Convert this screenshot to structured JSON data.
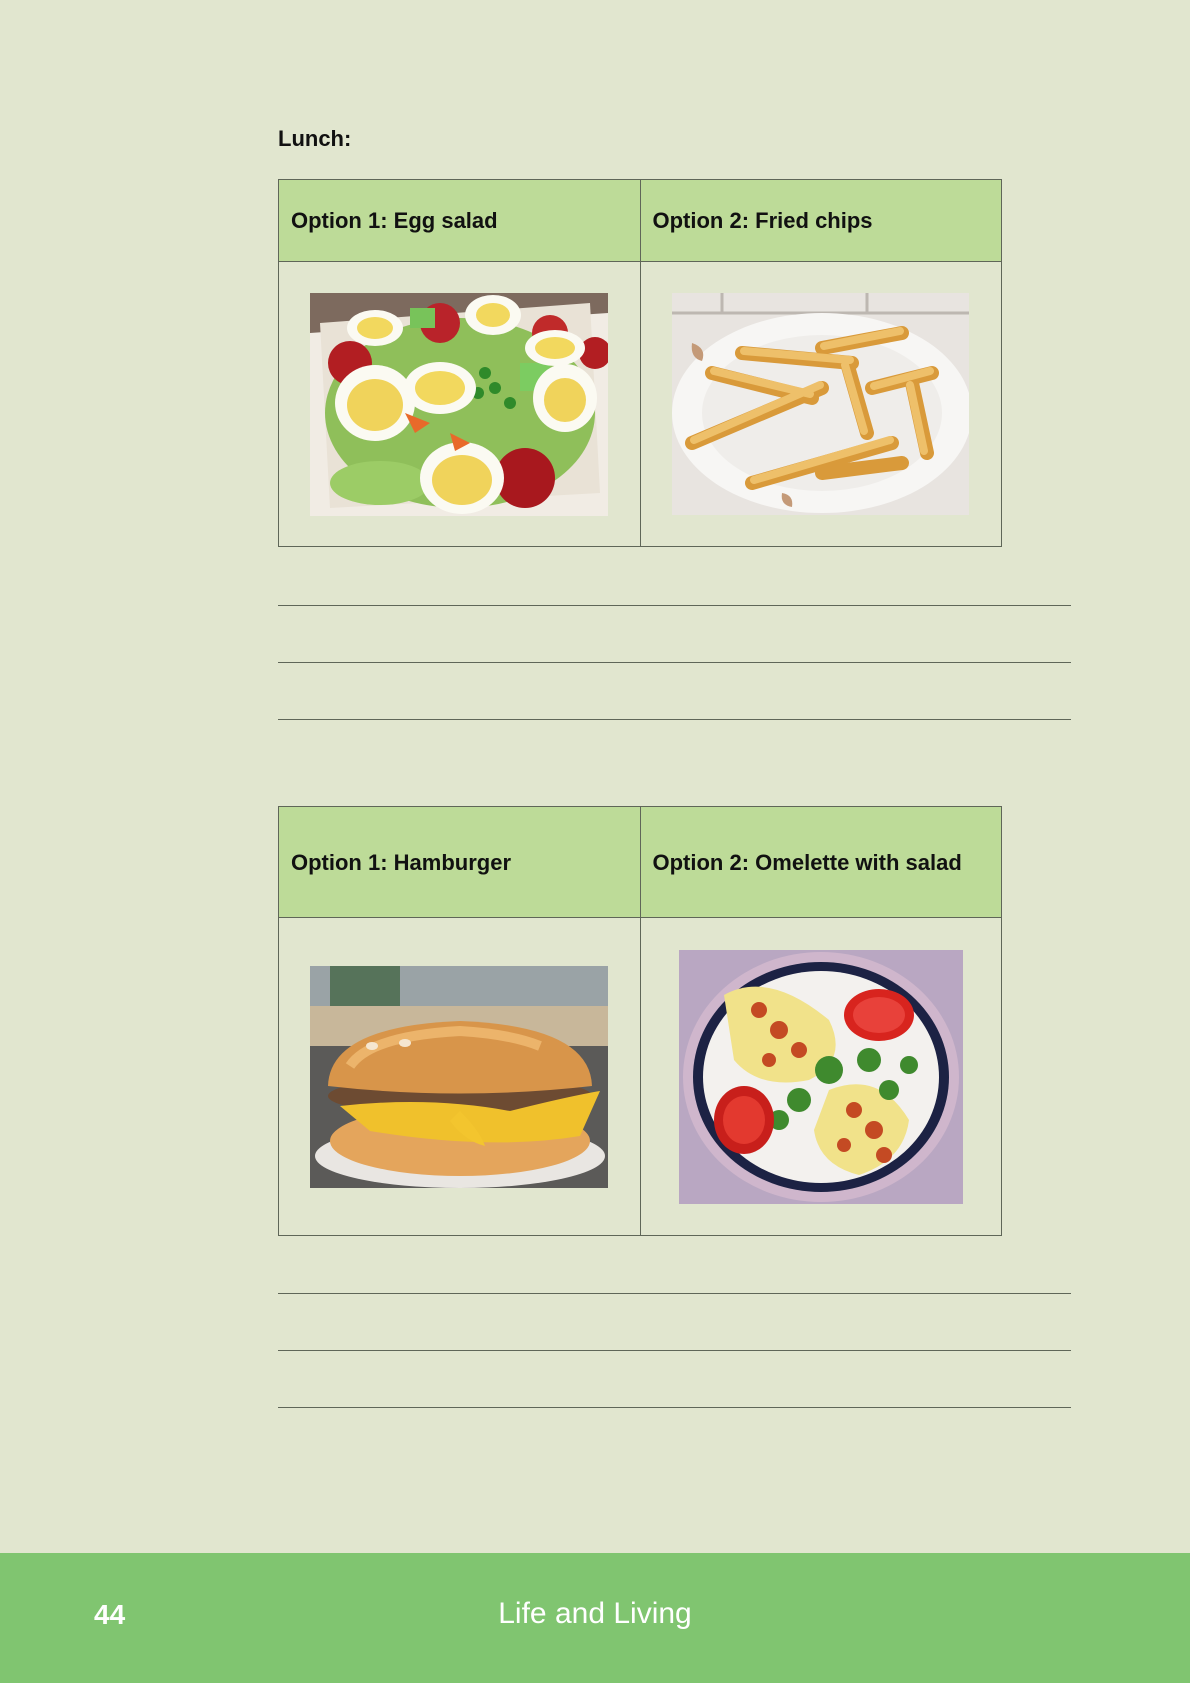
{
  "section_label": "Lunch:",
  "comparisons": [
    {
      "option1": {
        "label": "Option 1:",
        "name": "Egg salad",
        "image": "egg-salad-photo"
      },
      "option2": {
        "label": "Option 2:",
        "name": "Fried chips",
        "image": "fried-chips-photo"
      }
    },
    {
      "option1": {
        "label": "Option 1:",
        "name": "Hamburger",
        "image": "hamburger-photo"
      },
      "option2": {
        "label": "Option 2:",
        "name": "Omelette with salad",
        "image": "omelette-photo"
      }
    }
  ],
  "footer": {
    "page_number": "44",
    "title": "Life and Living"
  },
  "colors": {
    "page_background": "#e1e6cf",
    "header_cell": "#bddb98",
    "footer_band": "#80c570",
    "rule": "#5f6658"
  }
}
